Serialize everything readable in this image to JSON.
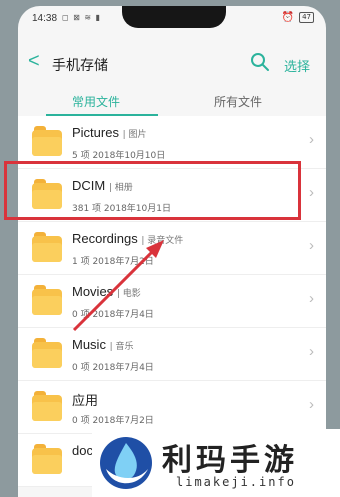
{
  "status": {
    "time": "14:38",
    "icons": "◻ ⊠ ≋ ▮",
    "battery": "47"
  },
  "header": {
    "back": "<",
    "title": "手机存储",
    "select_label": "选择"
  },
  "tabs": [
    {
      "label": "常用文件",
      "active": true
    },
    {
      "label": "所有文件",
      "active": false
    }
  ],
  "files": [
    {
      "name": "Pictures",
      "sub": "| 图片",
      "meta": "5 项  2018年10月10日"
    },
    {
      "name": "DCIM",
      "sub": "| 相册",
      "meta": "381 项  2018年10月1日"
    },
    {
      "name": "Recordings",
      "sub": "| 录音文件",
      "meta": "1 项  2018年7月2日"
    },
    {
      "name": "Movies",
      "sub": "| 电影",
      "meta": "0 项  2018年7月4日"
    },
    {
      "name": "Music",
      "sub": "| 音乐",
      "meta": "0 项  2018年7月4日"
    },
    {
      "name": "应用",
      "sub": "",
      "meta": "0 项  2018年7月2日"
    },
    {
      "name": "doc",
      "sub": "",
      "meta": ""
    }
  ],
  "watermark": {
    "title": "利玛手游",
    "subtitle": "limakeji.info"
  },
  "colors": {
    "accent": "#2bb39c",
    "highlight": "#d9333b",
    "folder": "#f8c24a"
  }
}
